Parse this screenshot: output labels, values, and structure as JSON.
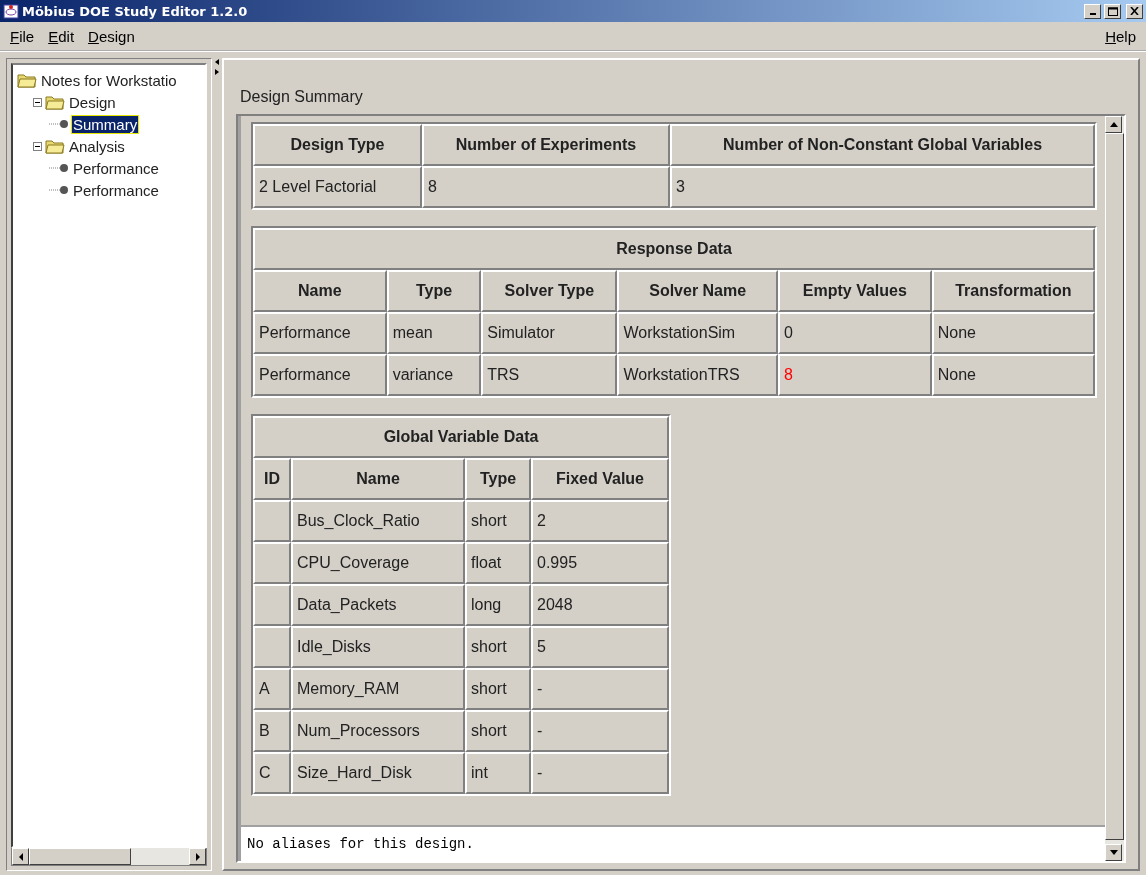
{
  "window": {
    "title": "Möbius DOE Study Editor 1.2.0"
  },
  "menu": {
    "left": [
      "File",
      "Edit",
      "Design"
    ],
    "right": [
      "Help"
    ]
  },
  "tree": [
    {
      "label": "Notes for Workstatio",
      "kind": "folder",
      "selected": false,
      "children": [
        {
          "label": "Design",
          "kind": "folder",
          "expanded": true,
          "selected": false,
          "children": [
            {
              "label": "Summary",
              "kind": "leaf",
              "selected": true
            }
          ]
        },
        {
          "label": "Analysis",
          "kind": "folder",
          "expanded": true,
          "selected": false,
          "children": [
            {
              "label": "Performance",
              "kind": "leaf",
              "selected": false
            },
            {
              "label": "Performance",
              "kind": "leaf",
              "selected": false
            }
          ]
        }
      ]
    }
  ],
  "panel_title": "Design Summary",
  "design_table": {
    "columns": [
      "Design Type",
      "Number of Experiments",
      "Number of Non-Constant Global Variables"
    ],
    "rows": [
      [
        "2 Level Factorial",
        "8",
        "3"
      ]
    ]
  },
  "response_table": {
    "title": "Response Data",
    "columns": [
      "Name",
      "Type",
      "Solver Type",
      "Solver Name",
      "Empty Values",
      "Transformation"
    ],
    "rows": [
      {
        "cells": [
          "Performance",
          "mean",
          "Simulator",
          "WorkstationSim",
          "0",
          "None"
        ],
        "empty_values_alert": false
      },
      {
        "cells": [
          "Performance",
          "variance",
          "TRS",
          "WorkstationTRS",
          "8",
          "None"
        ],
        "empty_values_alert": true
      }
    ]
  },
  "global_table": {
    "title": "Global Variable Data",
    "columns": [
      "ID",
      "Name",
      "Type",
      "Fixed Value"
    ],
    "rows": [
      [
        "",
        "Bus_Clock_Ratio",
        "short",
        "2"
      ],
      [
        "",
        "CPU_Coverage",
        "float",
        "0.995"
      ],
      [
        "",
        "Data_Packets",
        "long",
        "2048"
      ],
      [
        "",
        "Idle_Disks",
        "short",
        "5"
      ],
      [
        "A",
        "Memory_RAM",
        "short",
        "-"
      ],
      [
        "B",
        "Num_Processors",
        "short",
        "-"
      ],
      [
        "C",
        "Size_Hard_Disk",
        "int",
        "-"
      ]
    ]
  },
  "aliases_text": "No aliases for this design."
}
